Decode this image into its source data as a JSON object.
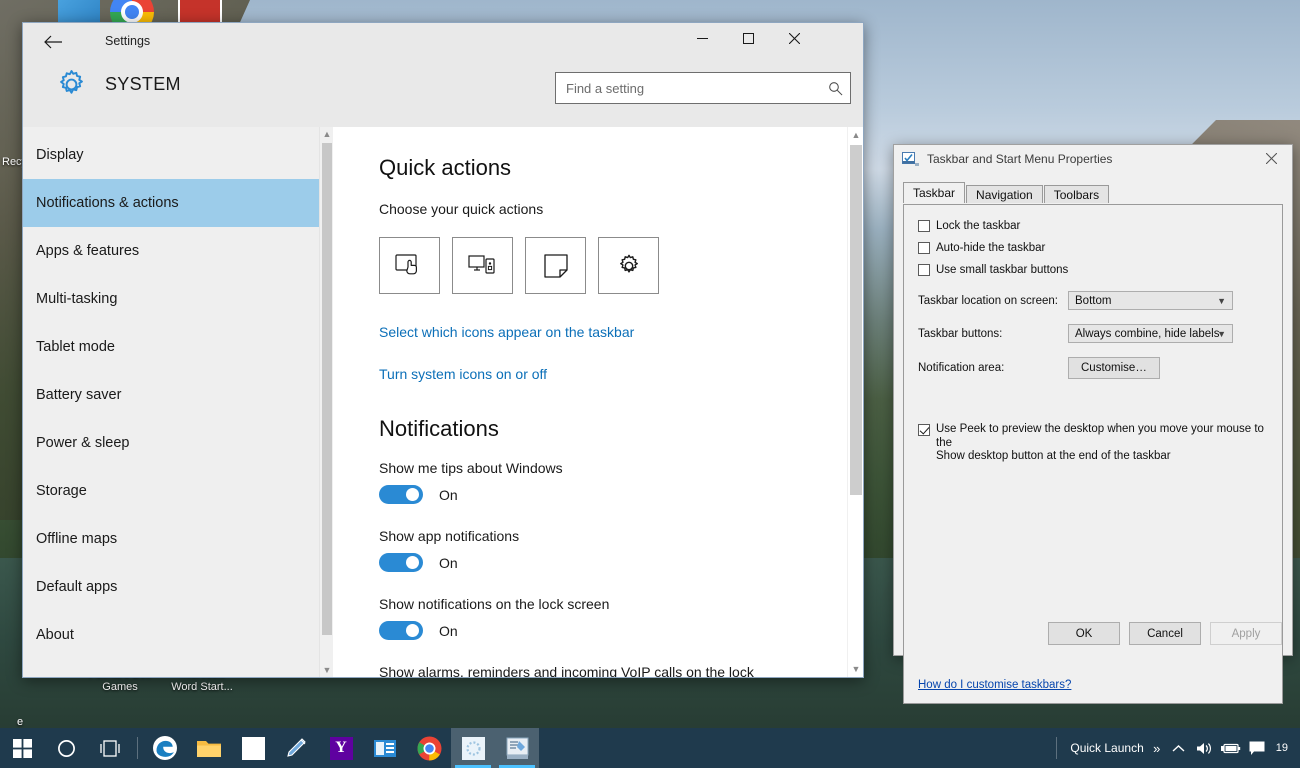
{
  "desktop": {
    "icons": [
      {
        "label": "Recycle Bin",
        "name": "recycle-bin"
      },
      {
        "label": "Packard Bell Games",
        "name": "packard-bell-games"
      },
      {
        "label": "Microsoft Word Start...",
        "name": "microsoft-word-start"
      },
      {
        "label": "e",
        "name": "edge-shortcut"
      }
    ]
  },
  "settings": {
    "titlebar": {
      "back": "←",
      "title": "Settings",
      "minimize": "─",
      "maximize": "☐",
      "close": "✕"
    },
    "header": {
      "category": "SYSTEM"
    },
    "search": {
      "placeholder": "Find a setting",
      "value": ""
    },
    "sidebar": {
      "items": [
        {
          "label": "Display",
          "active": false
        },
        {
          "label": "Notifications & actions",
          "active": true
        },
        {
          "label": "Apps & features",
          "active": false
        },
        {
          "label": "Multi-tasking",
          "active": false
        },
        {
          "label": "Tablet mode",
          "active": false
        },
        {
          "label": "Battery saver",
          "active": false
        },
        {
          "label": "Power & sleep",
          "active": false
        },
        {
          "label": "Storage",
          "active": false
        },
        {
          "label": "Offline maps",
          "active": false
        },
        {
          "label": "Default apps",
          "active": false
        },
        {
          "label": "About",
          "active": false
        }
      ]
    },
    "content": {
      "quick_actions_heading": "Quick actions",
      "quick_actions_sub": "Choose your quick actions",
      "tiles": [
        {
          "icon": "tablet-mode-icon"
        },
        {
          "icon": "connect-project-icon"
        },
        {
          "icon": "note-icon"
        },
        {
          "icon": "all-settings-gear-icon"
        }
      ],
      "links": [
        "Select which icons appear on the taskbar",
        "Turn system icons on or off"
      ],
      "notifications_heading": "Notifications",
      "toggles": [
        {
          "label": "Show me tips about Windows",
          "state": "On"
        },
        {
          "label": "Show app notifications",
          "state": "On"
        },
        {
          "label": "Show notifications on the lock screen",
          "state": "On"
        }
      ],
      "clipped_row": "Show alarms, reminders and incoming VoIP calls on the lock"
    }
  },
  "dialog": {
    "title": "Taskbar and Start Menu Properties",
    "close": "✕",
    "tabs": [
      {
        "label": "Taskbar",
        "active": true
      },
      {
        "label": "Navigation",
        "active": false
      },
      {
        "label": "Toolbars",
        "active": false
      }
    ],
    "checkboxes": [
      {
        "label": "Lock the taskbar",
        "checked": false
      },
      {
        "label": "Auto-hide the taskbar",
        "checked": false
      },
      {
        "label": "Use small taskbar buttons",
        "checked": false
      }
    ],
    "fields": [
      {
        "label": "Taskbar location on screen:",
        "value": "Bottom"
      },
      {
        "label": "Taskbar buttons:",
        "value": "Always combine, hide labels"
      }
    ],
    "notification_area": {
      "label": "Notification area:",
      "button": "Customise…"
    },
    "peek": {
      "checked": true,
      "line1": "Use Peek to preview the desktop when you move your mouse to the",
      "line2": "Show desktop button at the end of the taskbar"
    },
    "help_link": "How do I customise taskbars?",
    "buttons": {
      "ok": "OK",
      "cancel": "Cancel",
      "apply": "Apply"
    }
  },
  "taskbar": {
    "items": [
      {
        "name": "start-button",
        "icon": "windows-logo-icon"
      },
      {
        "name": "cortana-button",
        "icon": "cortana-circle-icon"
      },
      {
        "name": "task-view-button",
        "icon": "task-view-icon"
      },
      {
        "name": "edge-button",
        "icon": "edge-icon"
      },
      {
        "name": "file-explorer-button",
        "icon": "folder-icon"
      },
      {
        "name": "store-button",
        "icon": "store-icon"
      },
      {
        "name": "paint-button",
        "icon": "paint-icon"
      },
      {
        "name": "yahoo-button",
        "icon": "yahoo-icon"
      },
      {
        "name": "mail-button",
        "icon": "mail-icon"
      },
      {
        "name": "chrome-button",
        "icon": "chrome-icon"
      },
      {
        "name": "settings-button",
        "icon": "settings-window-icon"
      },
      {
        "name": "properties-button",
        "icon": "properties-window-icon"
      }
    ],
    "tray": {
      "quick_launch": "Quick Launch",
      "overflow": "»",
      "show_hidden": "∧",
      "volume_icon": "speaker-icon",
      "battery_icon": "battery-icon",
      "action_center_icon": "action-center-icon",
      "clock": "19"
    },
    "accent": "#1f3a4d"
  }
}
